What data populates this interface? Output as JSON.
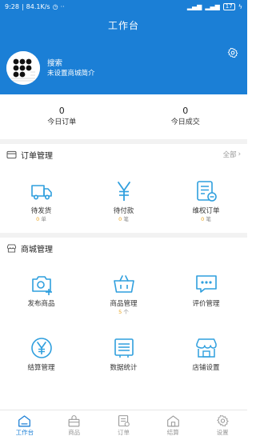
{
  "status_bar": {
    "time": "9:28",
    "speed": "84.1K/s",
    "battery": "17"
  },
  "header": {
    "title": "工作台"
  },
  "profile": {
    "name": "搜索",
    "description": "未设置商城简介"
  },
  "summary": [
    {
      "value": "0",
      "label": "今日订单"
    },
    {
      "value": "0",
      "label": "今日成交"
    }
  ],
  "order_section": {
    "title": "订单管理",
    "more_label": "全部",
    "items": [
      {
        "label": "待发货",
        "count": "0",
        "unit": "单",
        "icon": "truck-icon"
      },
      {
        "label": "待付款",
        "count": "0",
        "unit": "笔",
        "icon": "yen-icon"
      },
      {
        "label": "维权订单",
        "count": "0",
        "unit": "笔",
        "icon": "dispute-icon"
      }
    ]
  },
  "shop_section": {
    "title": "商城管理",
    "items": [
      {
        "label": "发布商品",
        "icon": "camera-add-icon"
      },
      {
        "label": "商品管理",
        "count": "5",
        "unit": "个",
        "icon": "basket-icon"
      },
      {
        "label": "评价管理",
        "icon": "comment-icon"
      },
      {
        "label": "结算管理",
        "icon": "yen-circle-icon"
      },
      {
        "label": "数据统计",
        "icon": "stats-icon"
      },
      {
        "label": "店铺设置",
        "icon": "shop-icon"
      }
    ]
  },
  "tabbar": [
    {
      "label": "工作台",
      "icon": "home-icon",
      "active": true
    },
    {
      "label": "商品",
      "icon": "bag-icon",
      "active": false
    },
    {
      "label": "订单",
      "icon": "order-icon",
      "active": false
    },
    {
      "label": "结算",
      "icon": "store-icon",
      "active": false
    },
    {
      "label": "设置",
      "icon": "settings-icon",
      "active": false
    }
  ],
  "colors": {
    "brand": "#1b7fd6",
    "accent": "#e8a31f",
    "icon_blue": "#2f9fde"
  }
}
